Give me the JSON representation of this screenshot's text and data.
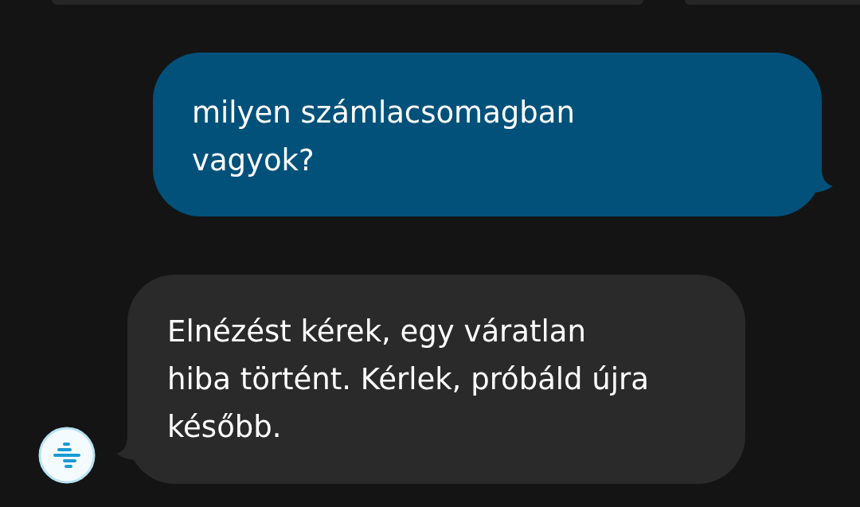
{
  "messages": [
    {
      "kind": "outgoing",
      "text": "milyen számlacsomagban vagyok?"
    },
    {
      "kind": "incoming",
      "text": "Elnézést kérek, egy váratlan hiba történt. Kérlek, próbáld újra később."
    }
  ]
}
